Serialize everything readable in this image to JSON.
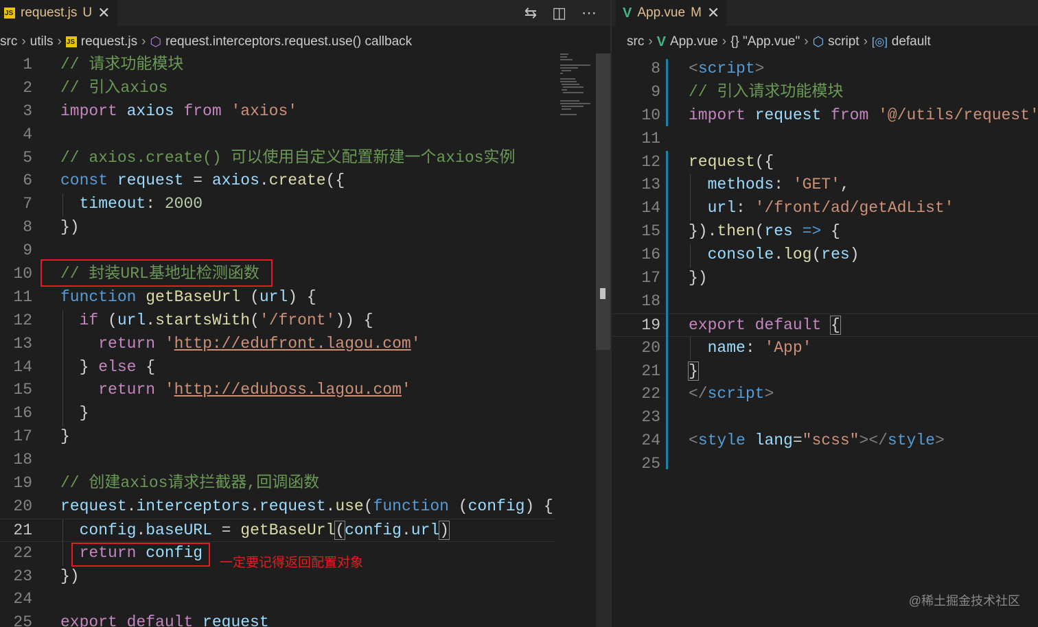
{
  "left_editor": {
    "tab": {
      "icon": "JS",
      "name": "request.js",
      "status": "U",
      "close": "✕"
    },
    "actions": [
      "⇆",
      "◫",
      "⋯"
    ],
    "breadcrumb": [
      "src",
      "utils",
      "request.js",
      "request.interceptors.request.use() callback"
    ],
    "breadcrumb_icon": "JS",
    "lines": [
      {
        "n": "1",
        "tokens": [
          [
            "// 请求功能模块",
            "cmt"
          ]
        ]
      },
      {
        "n": "2",
        "tokens": [
          [
            "// 引入axios",
            "cmt"
          ]
        ]
      },
      {
        "n": "3",
        "tokens": [
          [
            "import ",
            "kw"
          ],
          [
            "axios ",
            "var"
          ],
          [
            "from ",
            "kw"
          ],
          [
            "'axios'",
            "str"
          ]
        ]
      },
      {
        "n": "4",
        "tokens": []
      },
      {
        "n": "5",
        "tokens": [
          [
            "// axios.create() 可以使用自定义配置新建一个axios实例",
            "cmt"
          ]
        ]
      },
      {
        "n": "6",
        "tokens": [
          [
            "const ",
            "decl"
          ],
          [
            "request ",
            "var"
          ],
          [
            "= ",
            "pun"
          ],
          [
            "axios",
            "var"
          ],
          [
            ".",
            "pun"
          ],
          [
            "create",
            "fn"
          ],
          [
            "({",
            "pun"
          ]
        ]
      },
      {
        "n": "7",
        "tokens": [
          [
            "  ",
            "pun"
          ],
          [
            "timeout",
            "var"
          ],
          [
            ": ",
            "pun"
          ],
          [
            "2000",
            "num"
          ]
        ]
      },
      {
        "n": "8",
        "tokens": [
          [
            "})",
            "pun"
          ]
        ]
      },
      {
        "n": "9",
        "tokens": []
      },
      {
        "n": "10",
        "tokens": [
          [
            "// 封装URL基地址检测函数",
            "cmt"
          ]
        ]
      },
      {
        "n": "11",
        "tokens": [
          [
            "function ",
            "decl"
          ],
          [
            "getBaseUrl ",
            "fn"
          ],
          [
            "(",
            "pun"
          ],
          [
            "url",
            "var"
          ],
          [
            ") {",
            "pun"
          ]
        ]
      },
      {
        "n": "12",
        "tokens": [
          [
            "  ",
            "pun"
          ],
          [
            "if ",
            "kw"
          ],
          [
            "(",
            "pun"
          ],
          [
            "url",
            "var"
          ],
          [
            ".",
            "pun"
          ],
          [
            "startsWith",
            "fn"
          ],
          [
            "(",
            "pun"
          ],
          [
            "'/front'",
            "str"
          ],
          [
            ")) {",
            "pun"
          ]
        ]
      },
      {
        "n": "13",
        "tokens": [
          [
            "    ",
            "pun"
          ],
          [
            "return ",
            "kw"
          ],
          [
            "'",
            "str"
          ],
          [
            "http://edufront.lagou.com",
            "link"
          ],
          [
            "'",
            "str"
          ]
        ]
      },
      {
        "n": "14",
        "tokens": [
          [
            "  } ",
            "pun"
          ],
          [
            "else ",
            "kw"
          ],
          [
            "{",
            "pun"
          ]
        ]
      },
      {
        "n": "15",
        "tokens": [
          [
            "    ",
            "pun"
          ],
          [
            "return ",
            "kw"
          ],
          [
            "'",
            "str"
          ],
          [
            "http://eduboss.lagou.com",
            "link"
          ],
          [
            "'",
            "str"
          ]
        ]
      },
      {
        "n": "16",
        "tokens": [
          [
            "  }",
            "pun"
          ]
        ]
      },
      {
        "n": "17",
        "tokens": [
          [
            "}",
            "pun"
          ]
        ]
      },
      {
        "n": "18",
        "tokens": []
      },
      {
        "n": "19",
        "tokens": [
          [
            "// 创建axios请求拦截器,回调函数",
            "cmt"
          ]
        ]
      },
      {
        "n": "20",
        "tokens": [
          [
            "request",
            "var"
          ],
          [
            ".",
            "pun"
          ],
          [
            "interceptors",
            "var"
          ],
          [
            ".",
            "pun"
          ],
          [
            "request",
            "var"
          ],
          [
            ".",
            "pun"
          ],
          [
            "use",
            "fn"
          ],
          [
            "(",
            "pun"
          ],
          [
            "function ",
            "decl"
          ],
          [
            "(",
            "pun"
          ],
          [
            "config",
            "var"
          ],
          [
            ") {",
            "pun"
          ]
        ]
      },
      {
        "n": "21",
        "tokens": [
          [
            "  ",
            "pun"
          ],
          [
            "config",
            "var"
          ],
          [
            ".",
            "pun"
          ],
          [
            "baseURL ",
            "var"
          ],
          [
            "= ",
            "pun"
          ],
          [
            "getBaseUrl",
            "fn"
          ],
          [
            "(",
            "bracket-box"
          ],
          [
            "config",
            "var"
          ],
          [
            ".",
            "pun"
          ],
          [
            "url",
            "var"
          ],
          [
            ")",
            "bracket-box"
          ]
        ]
      },
      {
        "n": "22",
        "tokens": [
          [
            "  ",
            "pun"
          ],
          [
            "return ",
            "kw"
          ],
          [
            "config",
            "var"
          ]
        ]
      },
      {
        "n": "23",
        "tokens": [
          [
            "})",
            "pun"
          ]
        ]
      },
      {
        "n": "24",
        "tokens": []
      },
      {
        "n": "25",
        "tokens": [
          [
            "export ",
            "kw"
          ],
          [
            "default ",
            "kw"
          ],
          [
            "request",
            "var"
          ]
        ]
      }
    ],
    "annotation": "一定要记得返回配置对象"
  },
  "right_editor": {
    "tab": {
      "icon": "V",
      "name": "App.vue",
      "status": "M",
      "close": "✕"
    },
    "breadcrumb": [
      "src",
      "App.vue",
      "{} \"App.vue\"",
      "script",
      "default"
    ],
    "lines": [
      {
        "n": "8",
        "tokens": [
          [
            "<",
            "tag"
          ],
          [
            "script",
            "tagn"
          ],
          [
            ">",
            "tag"
          ]
        ]
      },
      {
        "n": "9",
        "tokens": [
          [
            "// 引入请求功能模块",
            "cmt"
          ]
        ]
      },
      {
        "n": "10",
        "tokens": [
          [
            "import ",
            "kw"
          ],
          [
            "request ",
            "var"
          ],
          [
            "from ",
            "kw"
          ],
          [
            "'@/utils/request'",
            "str"
          ]
        ]
      },
      {
        "n": "11",
        "tokens": []
      },
      {
        "n": "12",
        "tokens": [
          [
            "request",
            "fn"
          ],
          [
            "({",
            "pun"
          ]
        ]
      },
      {
        "n": "13",
        "tokens": [
          [
            "  ",
            "pun"
          ],
          [
            "methods",
            "var"
          ],
          [
            ": ",
            "pun"
          ],
          [
            "'GET'",
            "str"
          ],
          [
            ",",
            "pun"
          ]
        ]
      },
      {
        "n": "14",
        "tokens": [
          [
            "  ",
            "pun"
          ],
          [
            "url",
            "var"
          ],
          [
            ": ",
            "pun"
          ],
          [
            "'/front/ad/getAdList'",
            "str"
          ]
        ]
      },
      {
        "n": "15",
        "tokens": [
          [
            "}).",
            "pun"
          ],
          [
            "then",
            "fn"
          ],
          [
            "(",
            "pun"
          ],
          [
            "res ",
            "var"
          ],
          [
            "=> ",
            "decl"
          ],
          [
            "{",
            "pun"
          ]
        ]
      },
      {
        "n": "16",
        "tokens": [
          [
            "  ",
            "pun"
          ],
          [
            "console",
            "var"
          ],
          [
            ".",
            "pun"
          ],
          [
            "log",
            "fn"
          ],
          [
            "(",
            "pun"
          ],
          [
            "res",
            "var"
          ],
          [
            ")",
            "pun"
          ]
        ]
      },
      {
        "n": "17",
        "tokens": [
          [
            "})",
            "pun"
          ]
        ]
      },
      {
        "n": "18",
        "tokens": []
      },
      {
        "n": "19",
        "tokens": [
          [
            "export ",
            "kw"
          ],
          [
            "default ",
            "kw"
          ],
          [
            "{",
            "bracket-box"
          ]
        ]
      },
      {
        "n": "20",
        "tokens": [
          [
            "  ",
            "pun"
          ],
          [
            "name",
            "var"
          ],
          [
            ": ",
            "pun"
          ],
          [
            "'App'",
            "str"
          ]
        ]
      },
      {
        "n": "21",
        "tokens": [
          [
            "}",
            "bracket-box"
          ]
        ]
      },
      {
        "n": "22",
        "tokens": [
          [
            "</",
            "tag"
          ],
          [
            "script",
            "tagn"
          ],
          [
            ">",
            "tag"
          ]
        ]
      },
      {
        "n": "23",
        "tokens": []
      },
      {
        "n": "24",
        "tokens": [
          [
            "<",
            "tag"
          ],
          [
            "style ",
            "tagn"
          ],
          [
            "lang",
            "attr"
          ],
          [
            "=",
            "pun"
          ],
          [
            "\"scss\"",
            "str"
          ],
          [
            "></",
            "tag"
          ],
          [
            "style",
            "tagn"
          ],
          [
            ">",
            "tag"
          ]
        ]
      },
      {
        "n": "25",
        "tokens": []
      }
    ]
  },
  "watermark": "@稀土掘金技术社区"
}
